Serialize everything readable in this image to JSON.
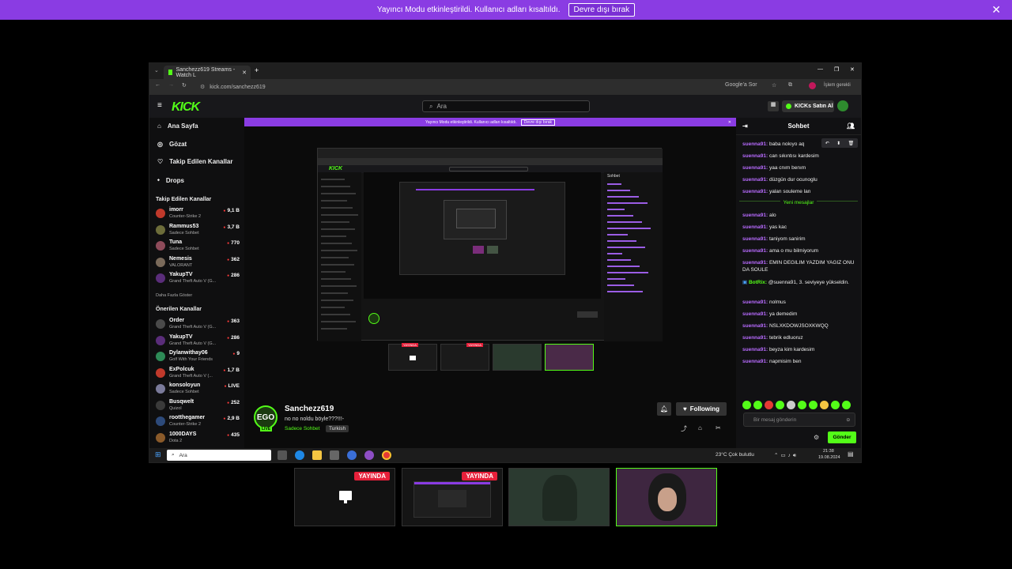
{
  "banner": {
    "text": "Yayıncı Modu etkinleştirildi. Kullanıcı adları kısaltıldı.",
    "button": "Devre dışı bırak",
    "close": "✕"
  },
  "browser": {
    "tab_title": "Sanchezz619 Streams - Watch L",
    "url": "kick.com/sanchezz619",
    "google_lens": "Google'a Sor",
    "profile": "İşlem gerekli",
    "window_controls": [
      "—",
      "❐",
      "✕"
    ]
  },
  "kick": {
    "logo": "KICK",
    "search_placeholder": "Ara",
    "ai_button": "KICKs Satın Al",
    "nav": [
      {
        "label": "Ana Sayfa",
        "icon": "home-icon",
        "glyph": "⌂"
      },
      {
        "label": "Gözat",
        "icon": "compass-icon",
        "glyph": "◎"
      },
      {
        "label": "Takip Edilen Kanallar",
        "icon": "heart-icon",
        "glyph": "♡"
      },
      {
        "label": "Drops",
        "icon": "drop-icon",
        "glyph": "⬩"
      }
    ],
    "following_header": "Takip Edilen Kanallar",
    "following": [
      {
        "name": "imorr",
        "game": "Counter-Strike 2",
        "viewers": "9,1 B",
        "color": "#c0392b"
      },
      {
        "name": "Rammus53",
        "game": "Sadece Sohbet",
        "viewers": "3,7 B",
        "color": "#6d6d3a"
      },
      {
        "name": "Tuna",
        "game": "Sadece Sohbet",
        "viewers": "770",
        "color": "#8e4b5a"
      },
      {
        "name": "Nemesis",
        "game": "VALORANT",
        "viewers": "362",
        "color": "#7a6a5a"
      },
      {
        "name": "YakupTV",
        "game": "Grand Theft Auto V (G...",
        "viewers": "286",
        "color": "#5a2d7a"
      }
    ],
    "show_more": "Daha Fazla Göster",
    "recommended_header": "Önerilen Kanallar",
    "recommended": [
      {
        "name": "Order",
        "game": "Grand Theft Auto V (G...",
        "viewers": "363",
        "color": "#4a4a4a"
      },
      {
        "name": "YakupTV",
        "game": "Grand Theft Auto V (G...",
        "viewers": "286",
        "color": "#5a2d7a"
      },
      {
        "name": "Dylanwithay06",
        "game": "Golf With Your Friends",
        "viewers": "9",
        "color": "#2e8b57"
      },
      {
        "name": "ExPolcuk",
        "game": "Grand Theft Auto V (...",
        "viewers": "1,7 B",
        "color": "#c0392b"
      },
      {
        "name": "konsoloyun",
        "game": "Sadece Sohbet",
        "viewers": "LIVE",
        "color": "#7a7a9a"
      },
      {
        "name": "Busqwelt",
        "game": "Quizol",
        "viewers": "252",
        "color": "#3a3a3a"
      },
      {
        "name": "rootthegamer",
        "game": "Counter-Strike 2",
        "viewers": "2,9 B",
        "color": "#2d4a7a"
      },
      {
        "name": "1000DAYS",
        "game": "Dota 2",
        "viewers": "435",
        "color": "#8a5a2a"
      }
    ],
    "sub_banner": "Yayıncı Modu etkinleştirildi. Kullanıcı adları kısaltıldı.",
    "sub_banner_btn": "Devre dışı bırak",
    "stream": {
      "logo": "EGO",
      "live": "LIVE",
      "name": "Sanchezz619",
      "title": "no no noldu böyle???!!!-",
      "category": "Sadece Sohbet",
      "language": "Turkish",
      "follow_label": "Following"
    },
    "chat": {
      "title": "Sohbet",
      "new_messages": "Yeni mesajlar",
      "messages_before": [
        {
          "user": "suenna91:",
          "text": "baba nokıyo aq"
        },
        {
          "user": "suenna91:",
          "text": "can sıkıntısı kardesim"
        },
        {
          "user": "suenna91:",
          "text": "yaa cnım benım"
        },
        {
          "user": "suenna91:",
          "text": "düzgün dur ocunoglu"
        },
        {
          "user": "suenna91:",
          "text": "yalan souleme lan"
        }
      ],
      "messages_after": [
        {
          "user": "suenna91:",
          "text": "alo"
        },
        {
          "user": "suenna91:",
          "text": "yas kac"
        },
        {
          "user": "suenna91:",
          "text": "taniyom sanirim"
        },
        {
          "user": "suenna91:",
          "text": "ama o mu bilmiyorum"
        },
        {
          "user": "suenna91:",
          "text": "EMIN DEGILIM YAZDIM YAGIZ ONU DA SOULE"
        },
        {
          "user": "BotRix:",
          "text": "@suenna91, 3. seviyeye yükseldin.",
          "bot": true
        },
        {
          "user": "suenna91:",
          "text": "nolmus"
        },
        {
          "user": "suenna91:",
          "text": "ya demedim"
        },
        {
          "user": "suenna91:",
          "text": "NSLXKDOWJSOXKWQQ"
        },
        {
          "user": "suenna91:",
          "text": "tebrik edluoruz"
        },
        {
          "user": "suenna91:",
          "text": "beyza kim kardesim"
        },
        {
          "user": "suenna91:",
          "text": "napmisim ben"
        }
      ],
      "input_placeholder": "Bir mesaj gönderin",
      "send": "Gönder"
    }
  },
  "taskbar": {
    "search": "Ara",
    "weather": "23°C  Çok bulutlu",
    "time": "21:38",
    "date": "19.08.2024"
  },
  "thumbnails": [
    {
      "badge": "YAYINDA"
    },
    {
      "badge": "YAYINDA"
    },
    {
      "badge": ""
    },
    {
      "badge": ""
    }
  ],
  "colors": {
    "kick_green": "#53fc18",
    "banner_purple": "#8a3ce3",
    "live_red": "#e6203a"
  }
}
